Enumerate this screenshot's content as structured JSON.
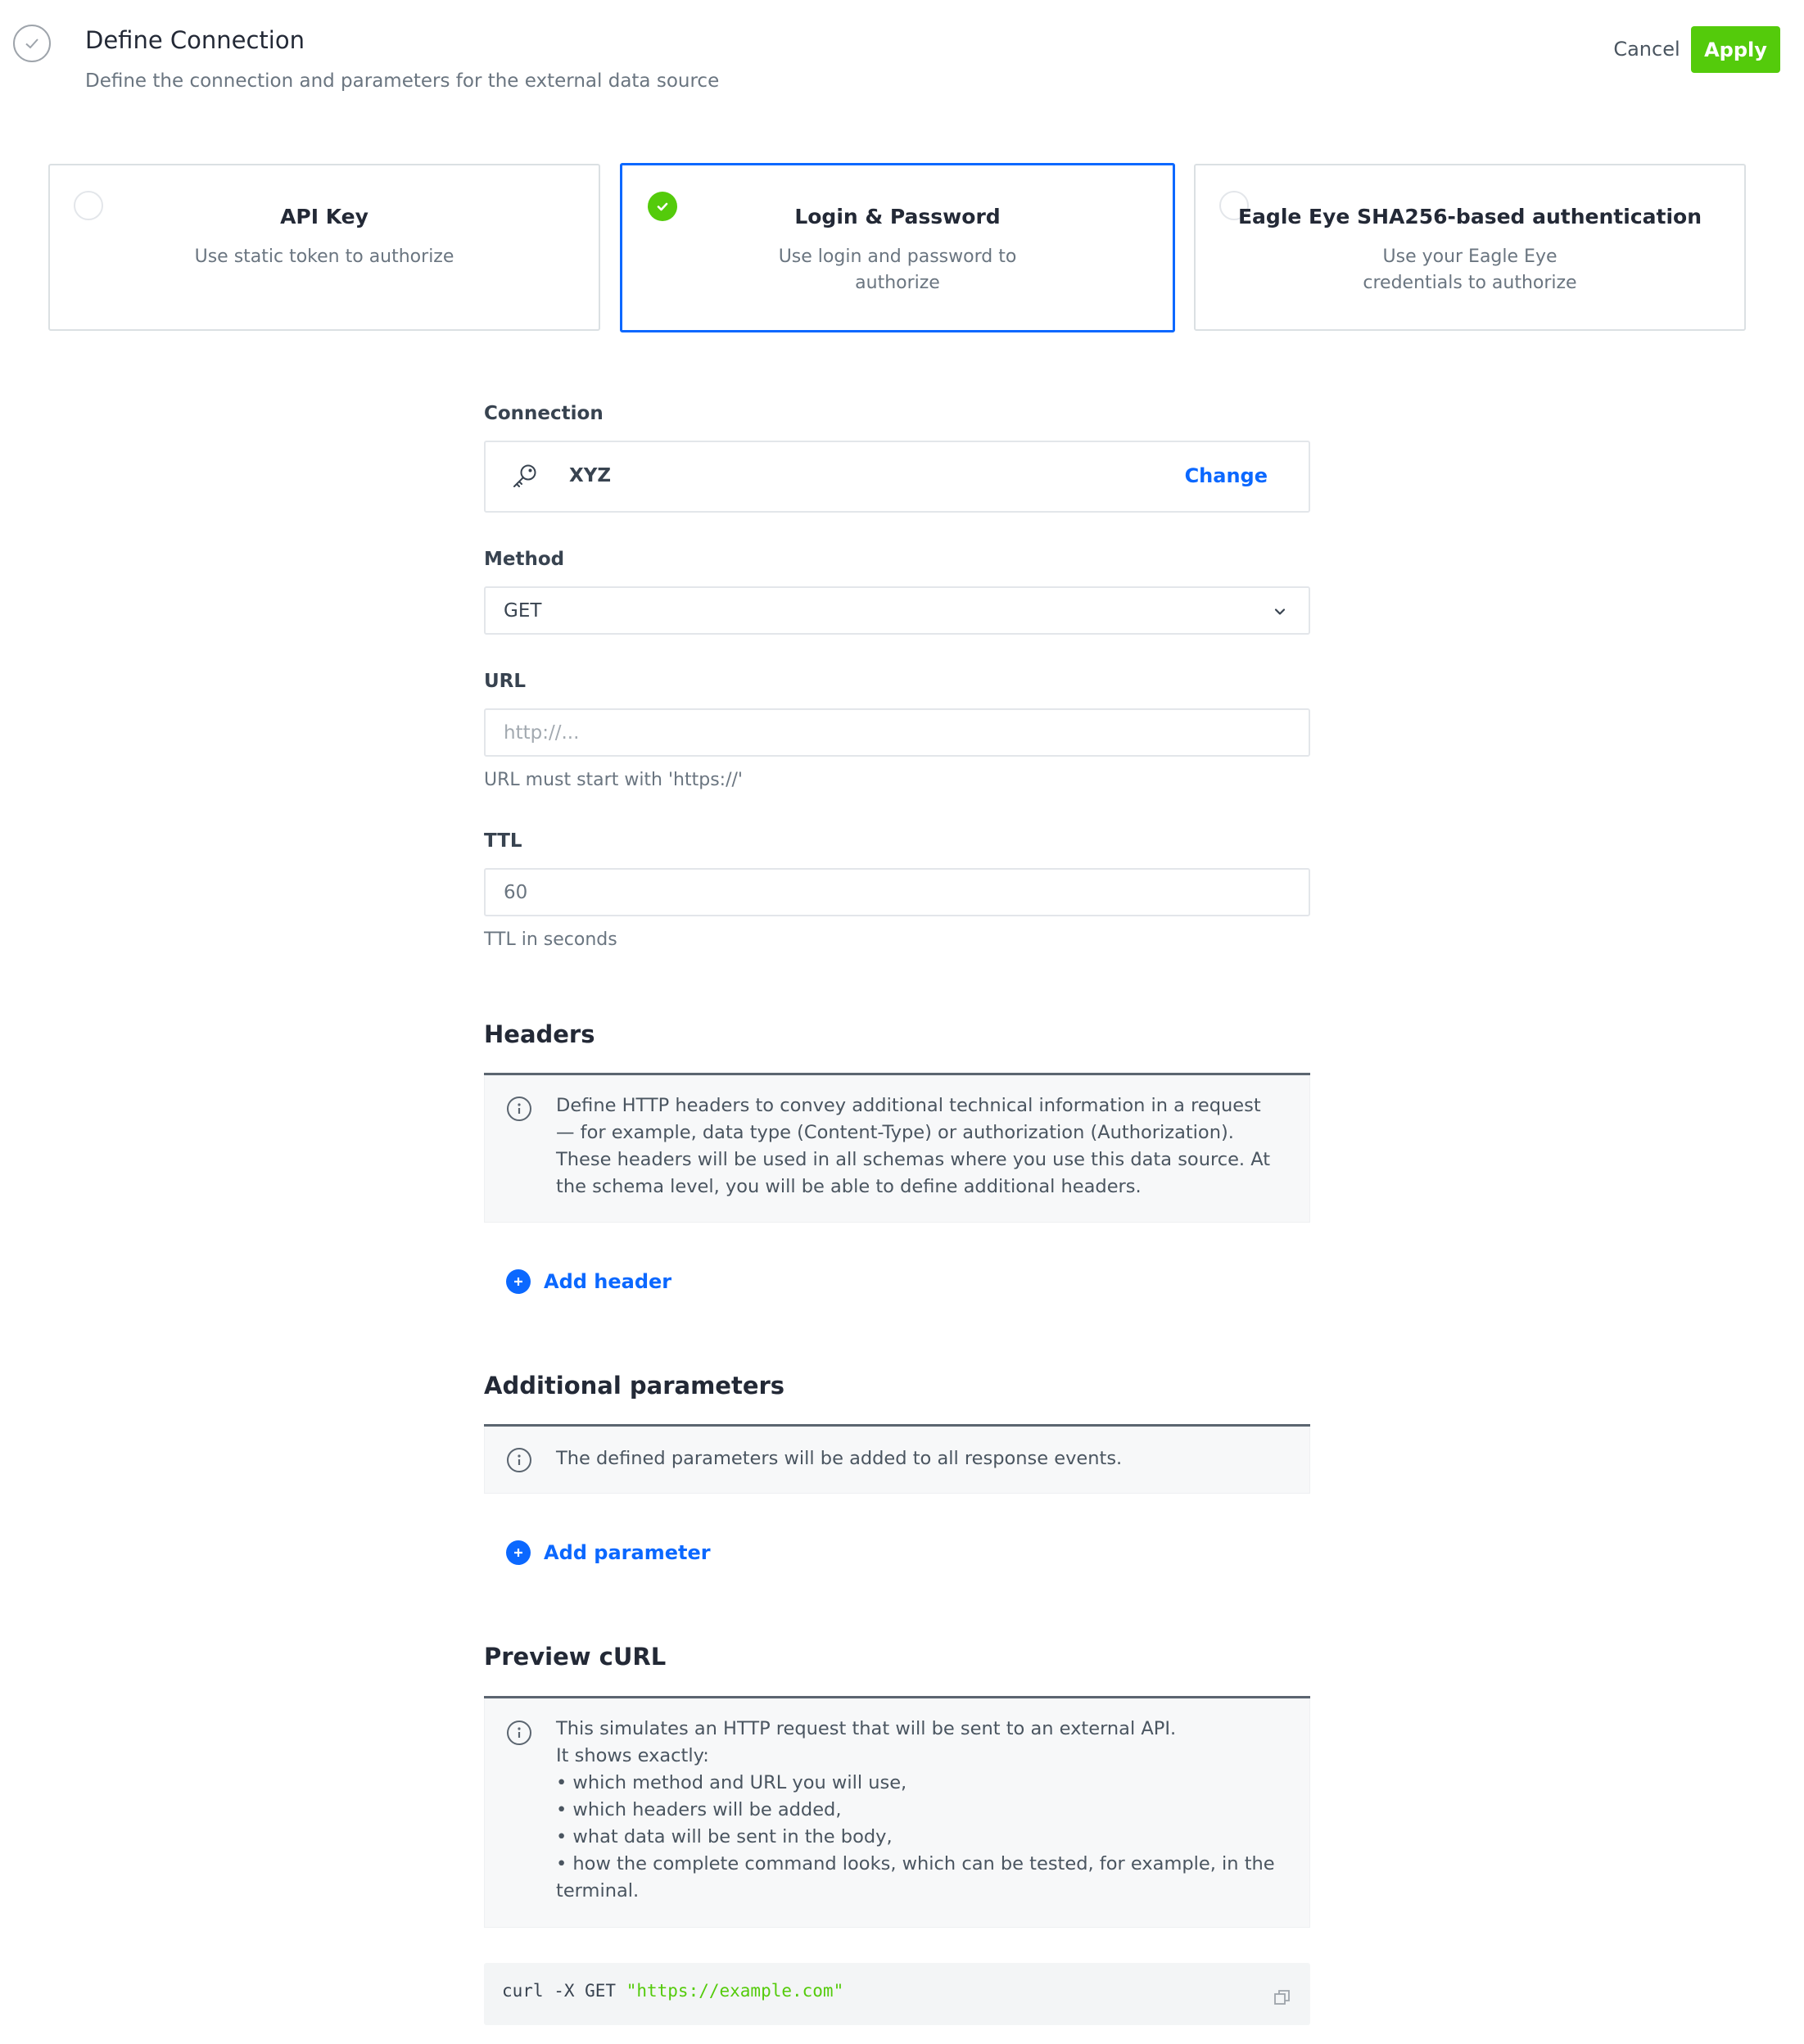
{
  "header": {
    "title": "Define Connection",
    "subtitle": "Define the connection and parameters for the external data source",
    "cancel_label": "Cancel",
    "apply_label": "Apply",
    "step_icon": "check-circle-icon"
  },
  "auth_options": [
    {
      "title": "API Key",
      "description": "Use static token to authorize",
      "selected": false
    },
    {
      "title": "Login & Password",
      "description": "Use login and password to authorize",
      "selected": true
    },
    {
      "title": "Eagle Eye SHA256-based authentication",
      "description": "Use your Eagle Eye credentials to authorize",
      "selected": false
    }
  ],
  "connection": {
    "label": "Connection",
    "value": "XYZ",
    "change_label": "Change",
    "icon": "key-icon"
  },
  "method": {
    "label": "Method",
    "value": "GET",
    "icon": "chevron-down-icon"
  },
  "url": {
    "label": "URL",
    "placeholder": "http://...",
    "value": "",
    "hint": "URL must start with 'https://'"
  },
  "ttl": {
    "label": "TTL",
    "value": "60",
    "hint": "TTL in seconds"
  },
  "headers": {
    "title": "Headers",
    "info": "Define HTTP headers to convey additional technical information in a request — for example, data type (Content-Type) or authorization (Authorization). These headers will be used in all schemas where you use this data source. At the schema level, you will be able to define additional headers.",
    "add_label": "Add header"
  },
  "parameters": {
    "title": "Additional parameters",
    "info": "The defined parameters will be added to all response events.",
    "add_label": "Add parameter"
  },
  "preview": {
    "title": "Preview cURL",
    "info_lines": [
      "This simulates an HTTP request that will be sent to an external API.",
      "It shows exactly:",
      "• which method and URL you will use,",
      "• which headers will be added,",
      "• what data will be sent in the body,",
      "• how the complete command looks, which can be tested, for example, in the terminal."
    ],
    "code_command": "curl -X GET ",
    "code_url": "\"https://example.com\"",
    "copy_icon": "copy-icon"
  },
  "colors": {
    "accent_blue": "#0b68ff",
    "apply_green": "#54cb0b",
    "text_dark": "#232936",
    "text_muted": "#6a7580"
  }
}
